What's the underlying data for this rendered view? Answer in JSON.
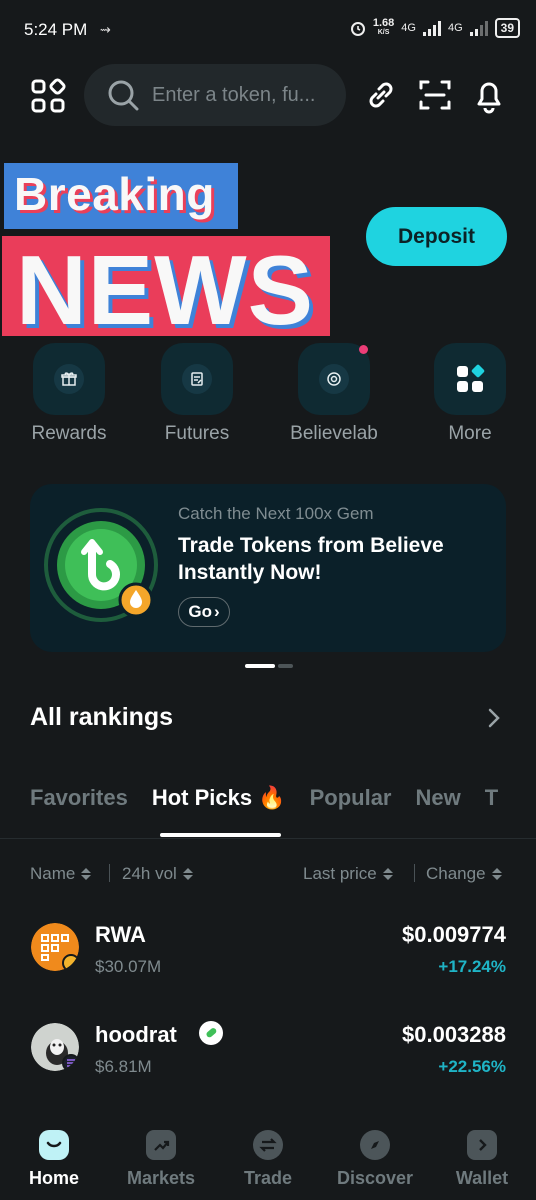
{
  "status_bar": {
    "time": "5:24 PM",
    "speed": "1.68",
    "speed_unit": "K/S",
    "net1": "4G",
    "net2": "4G",
    "battery": "39"
  },
  "search": {
    "placeholder": "Enter a token, fu..."
  },
  "overlay": {
    "line1": "Breaking",
    "line2": "NEWS"
  },
  "deposit_label": "Deposit",
  "quick_actions": [
    {
      "label": "Rewards",
      "icon": "gift-icon"
    },
    {
      "label": "Futures",
      "icon": "futures-icon"
    },
    {
      "label": "Believelab",
      "icon": "believelab-icon"
    },
    {
      "label": "More",
      "icon": "more-icon"
    }
  ],
  "banner": {
    "subtitle": "Catch the Next 100x Gem",
    "title": "Trade Tokens from Believe Instantly Now!",
    "button": "Go"
  },
  "rankings": {
    "title": "All rankings",
    "tabs": [
      "Favorites",
      "Hot Picks 🔥",
      "Popular",
      "New",
      "T"
    ],
    "active_tab": 1,
    "columns": {
      "name": "Name",
      "vol": "24h vol",
      "price": "Last price",
      "change": "Change"
    },
    "rows": [
      {
        "name": "RWA",
        "vol": "$30.07M",
        "price": "$0.009774",
        "change": "+17.24%"
      },
      {
        "name": "hoodrat",
        "vol": "$6.81M",
        "price": "$0.003288",
        "change": "+22.56%"
      }
    ]
  },
  "nav": [
    {
      "label": "Home",
      "icon": "home-icon",
      "active": true
    },
    {
      "label": "Markets",
      "icon": "markets-icon"
    },
    {
      "label": "Trade",
      "icon": "trade-icon"
    },
    {
      "label": "Discover",
      "icon": "discover-icon"
    },
    {
      "label": "Wallet",
      "icon": "wallet-icon"
    }
  ],
  "colors": {
    "accent": "#1fd3e0",
    "positive": "#1fb4c6",
    "background": "#16191b"
  }
}
